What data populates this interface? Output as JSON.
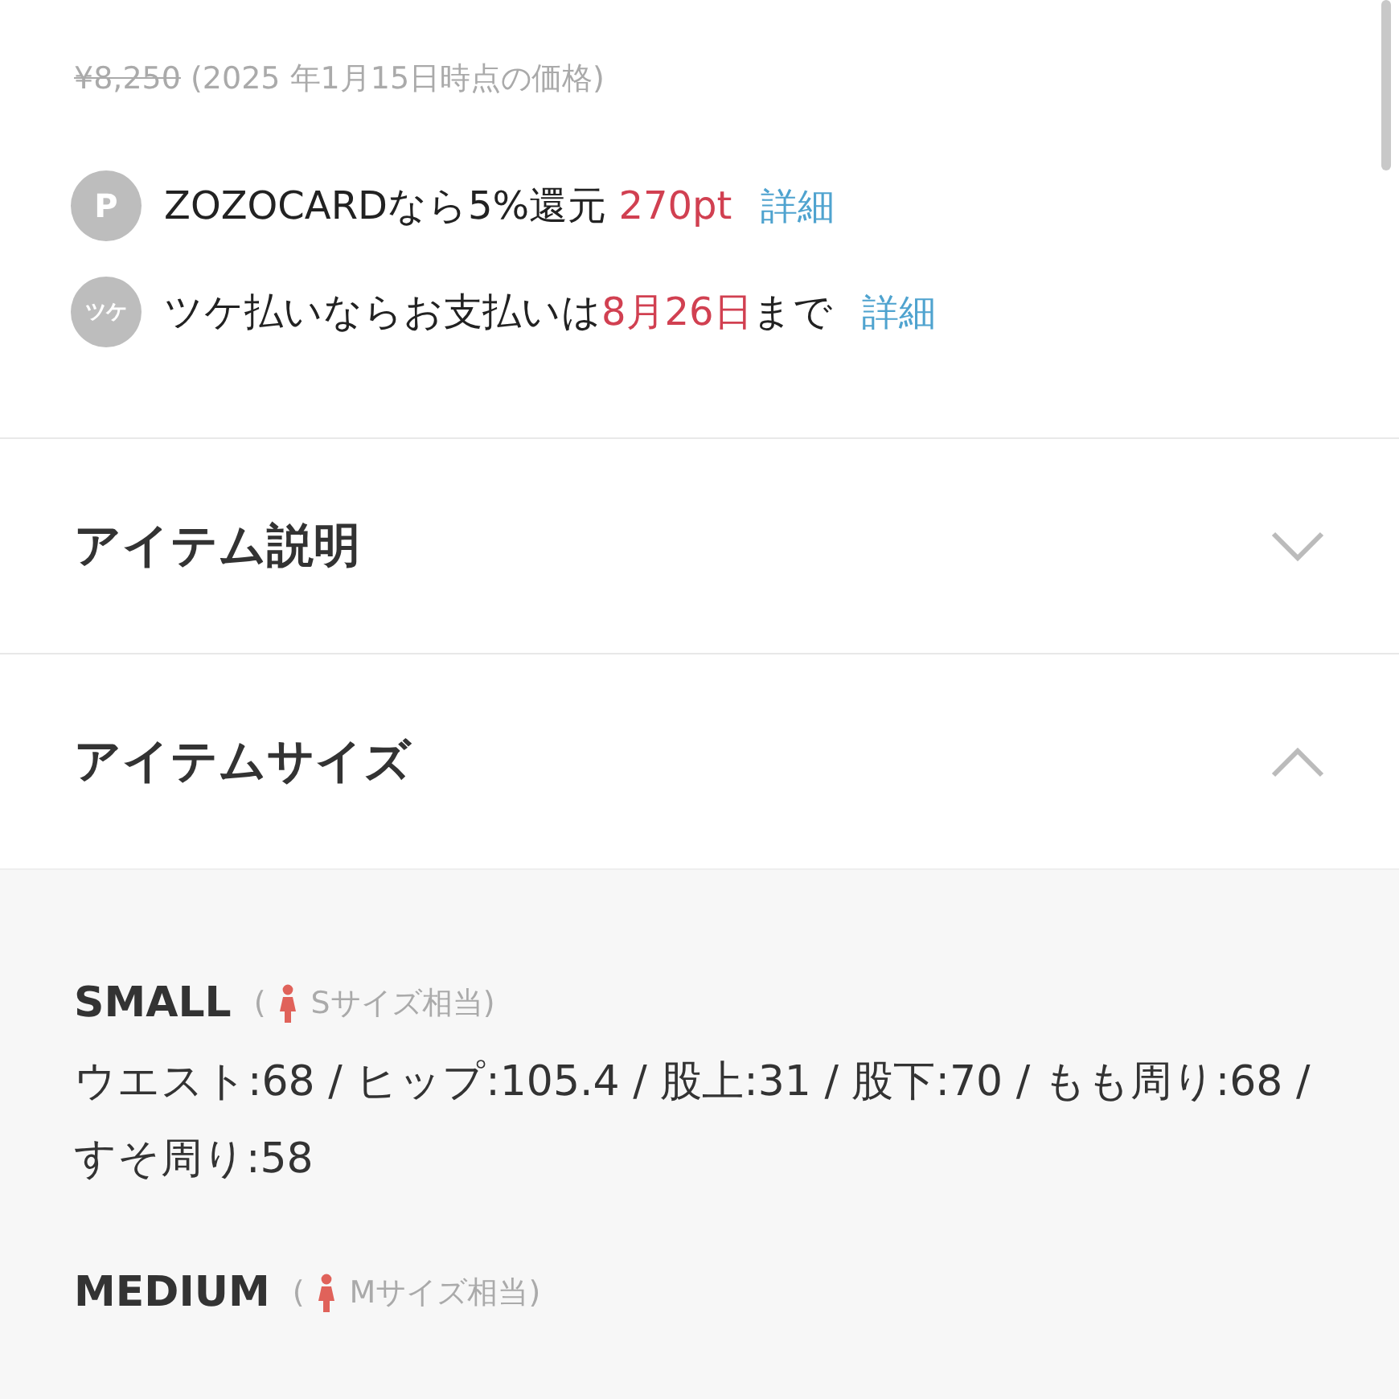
{
  "old_price": "¥8,250",
  "price_note": "(2025 年1月15日時点の価格)",
  "offers": [
    {
      "icon": "P",
      "text": "ZOZOCARDなら5%還元 ",
      "highlight": "270pt",
      "link": "詳細"
    },
    {
      "icon": "ツケ",
      "text": "ツケ払いならお支払いは",
      "highlight": "8月26日",
      "after": "まで",
      "link": "詳細"
    }
  ],
  "sections": [
    {
      "title": "アイテム説明",
      "expanded": false
    },
    {
      "title": "アイテムサイズ",
      "expanded": true,
      "sizes": [
        {
          "name": "SMALL",
          "note_open": "(",
          "note": "Sサイズ相当)",
          "measurements": "ウエスト:68 / ヒップ:105.4 / 股上:31 / 股下:70 / もも周り:68 / すそ周り:58"
        },
        {
          "name": "MEDIUM",
          "note_open": "(",
          "note": "Mサイズ相当)"
        }
      ]
    }
  ]
}
